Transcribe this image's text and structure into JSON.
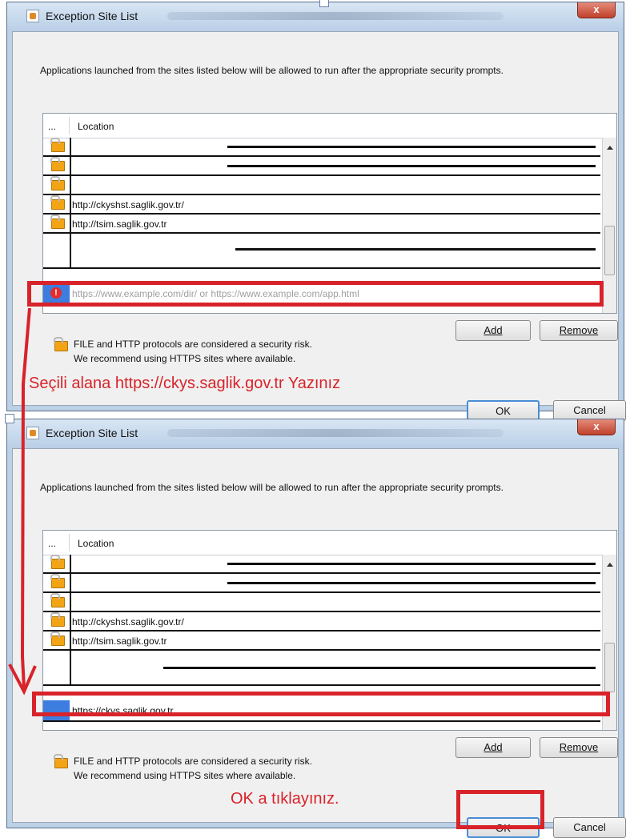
{
  "colors": {
    "annotation": "#d8232a",
    "selection": "#3d7de0",
    "lock": "#f2a415"
  },
  "dialog_top": {
    "title": "Exception Site List",
    "close_label": "x",
    "description": "Applications launched from the sites listed below will be allowed to run after the appropriate security prompts.",
    "table": {
      "col_dots": "...",
      "col_location": "Location",
      "rows": [
        "",
        "",
        "",
        "http://ckyshst.saglik.gov.tr/",
        "http://tsim.saglik.gov.tr",
        ""
      ],
      "edit_placeholder": "https://www.example.com/dir/ or https://www.example.com/app.html",
      "edit_value": ""
    },
    "add_label": "Add",
    "remove_label": "Remove",
    "risk_line1": "FILE and HTTP protocols are considered a security risk.",
    "risk_line2": "We recommend using HTTPS sites where available.",
    "ok_label": "OK",
    "cancel_label": "Cancel",
    "instruction": "Seçili alana https://ckys.saglik.gov.tr Yazınız"
  },
  "dialog_bottom": {
    "title": "Exception Site List",
    "close_label": "x",
    "description": "Applications launched from the sites listed below will be allowed to run after the appropriate security prompts.",
    "table": {
      "col_dots": "...",
      "col_location": "Location",
      "rows": [
        "",
        "",
        "",
        "http://ckyshst.saglik.gov.tr/",
        "http://tsim.saglik.gov.tr",
        ""
      ],
      "edit_value": "https://ckys.saglik.gov.tr"
    },
    "add_label": "Add",
    "remove_label": "Remove",
    "risk_line1": "FILE and HTTP protocols are considered a security risk.",
    "risk_line2": "We recommend using HTTPS sites where available.",
    "ok_label": "OK",
    "cancel_label": "Cancel",
    "instruction": "OK a tıklayınız."
  }
}
